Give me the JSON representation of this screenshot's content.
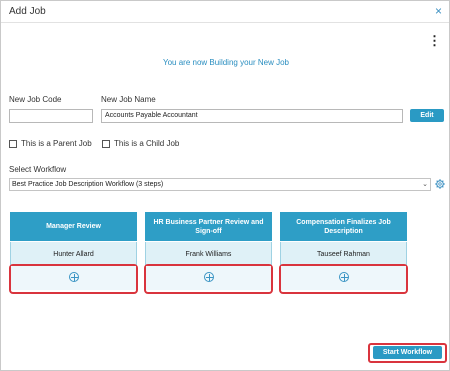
{
  "dialog": {
    "title": "Add Job",
    "close_icon": "×",
    "more_icon": "⋮"
  },
  "subtitle": "You are now Building your New Job",
  "form": {
    "job_code_label": "New Job Code",
    "job_code_value": "",
    "job_name_label": "New Job Name",
    "job_name_value": "Accounts Payable Accountant",
    "edit_label": "Edit",
    "parent_label": "This is a Parent Job",
    "child_label": "This is a Child Job",
    "workflow_label": "Select Workflow",
    "workflow_value": "Best Practice Job Description Workflow (3 steps)"
  },
  "steps": [
    {
      "title": "Manager Review",
      "person": "Hunter Allard"
    },
    {
      "title": "HR Business Partner Review and Sign-off",
      "person": "Frank Williams"
    },
    {
      "title": "Compensation Finalizes Job Description",
      "person": "Tauseef Rahman"
    }
  ],
  "start_label": "Start Workflow",
  "colors": {
    "accent": "#2a9ac4",
    "highlight": "#d9343d",
    "step_header": "#2e9ec6",
    "step_person_bg": "#dff1f7"
  },
  "icons": {
    "close": "close-icon",
    "more": "more-options-icon",
    "gear": "gear-icon",
    "add": "add-circle-icon"
  }
}
